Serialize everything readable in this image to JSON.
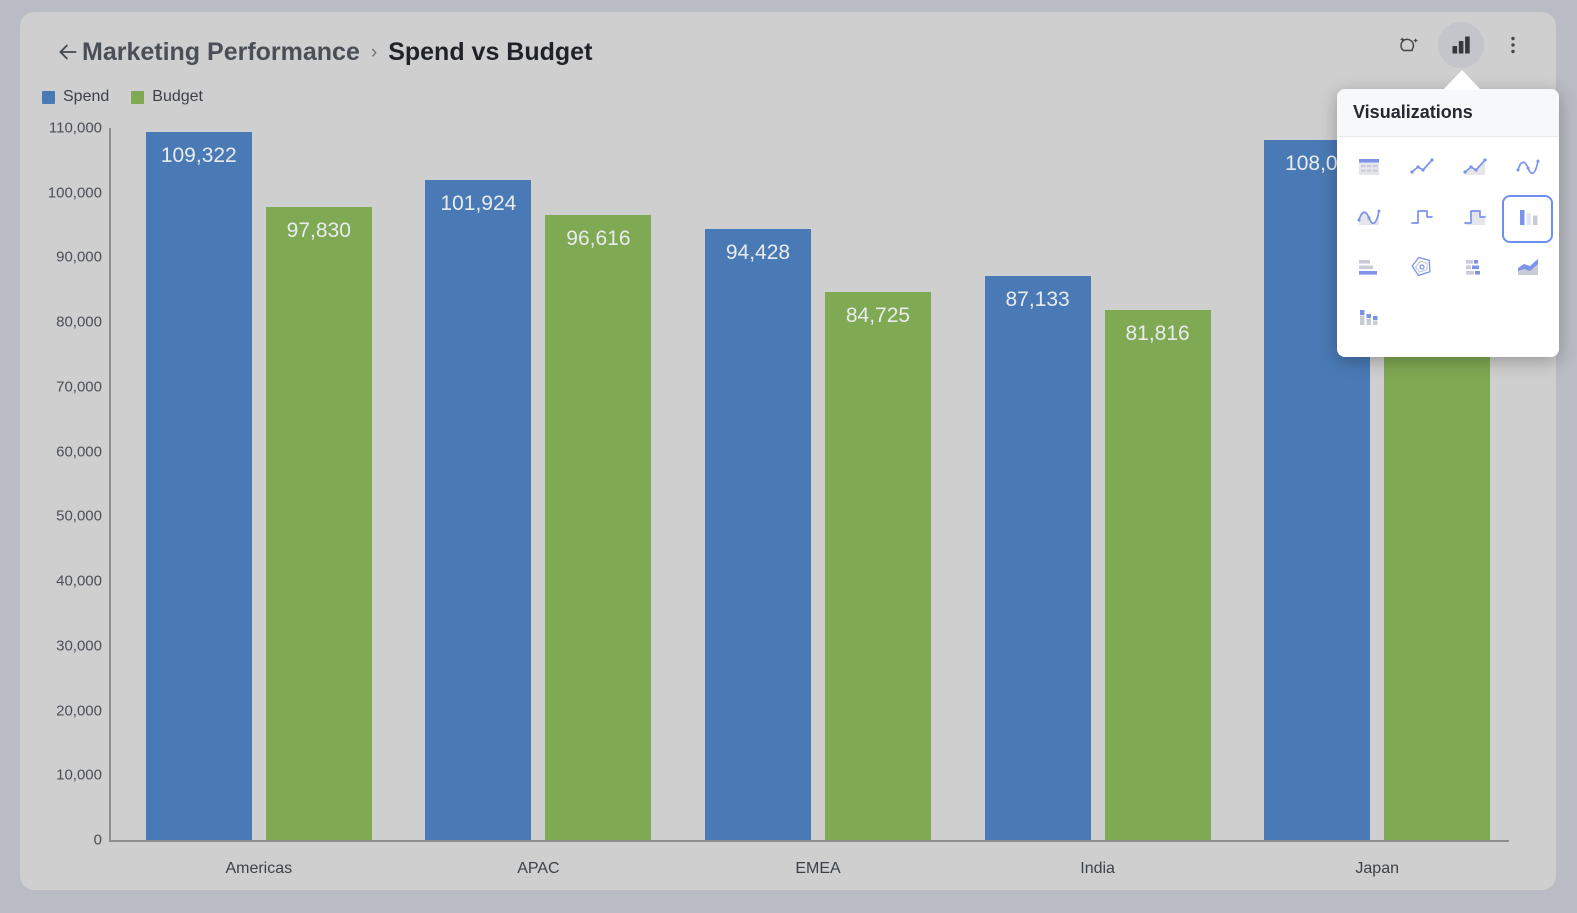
{
  "header": {
    "back_icon": "arrow-left-icon",
    "breadcrumb_parent": "Marketing Performance",
    "breadcrumb_separator": "›",
    "breadcrumb_current": "Spend vs Budget",
    "tools": [
      {
        "name": "ai-insights-icon",
        "label": "AI Insights",
        "active": false
      },
      {
        "name": "visualizations-icon",
        "label": "Visualizations",
        "active": true
      },
      {
        "name": "more-options-icon",
        "label": "More options",
        "active": false
      }
    ]
  },
  "legend": [
    {
      "label": "Spend",
      "color": "#4a7ab5"
    },
    {
      "label": "Budget",
      "color": "#7fa953"
    }
  ],
  "visualizations_panel": {
    "title": "Visualizations",
    "selected": "column-chart",
    "items": [
      {
        "name": "table-icon",
        "label": "Table"
      },
      {
        "name": "line-chart-icon",
        "label": "Line"
      },
      {
        "name": "area-chart-icon",
        "label": "Area"
      },
      {
        "name": "spline-line-icon",
        "label": "Spline"
      },
      {
        "name": "spline-area-icon",
        "label": "Spline Area"
      },
      {
        "name": "step-line-icon",
        "label": "Step Line"
      },
      {
        "name": "step-area-icon",
        "label": "Step Area"
      },
      {
        "name": "column-chart-icon",
        "label": "Column"
      },
      {
        "name": "bar-chart-icon",
        "label": "Bar"
      },
      {
        "name": "pie-chart-icon",
        "label": "Pie"
      },
      {
        "name": "stacked-bar-icon",
        "label": "Stacked Bar"
      },
      {
        "name": "stacked-area-icon",
        "label": "Stacked Area"
      },
      {
        "name": "stacked-column-icon",
        "label": "Stacked Column"
      }
    ]
  },
  "chart_data": {
    "type": "bar",
    "title": "Spend vs Budget",
    "xlabel": "",
    "ylabel": "",
    "ylim": [
      0,
      110000
    ],
    "grid": false,
    "legend_position": "top-left",
    "categories": [
      "Americas",
      "APAC",
      "EMEA",
      "India",
      "Japan"
    ],
    "ytick_labels": [
      "110,000",
      "100,000",
      "90,000",
      "80,000",
      "70,000",
      "60,000",
      "50,000",
      "40,000",
      "30,000",
      "20,000",
      "10,000",
      "0"
    ],
    "ytick_values": [
      110000,
      100000,
      90000,
      80000,
      70000,
      60000,
      50000,
      40000,
      30000,
      20000,
      10000,
      0
    ],
    "series": [
      {
        "name": "Spend",
        "color": "#4a7ab5",
        "values": [
          109322,
          101924,
          94428,
          87133,
          108090
        ],
        "labels": [
          "109,322",
          "101,924",
          "94,428",
          "87,133",
          "108,09"
        ]
      },
      {
        "name": "Budget",
        "color": "#7fa953",
        "values": [
          97830,
          96616,
          84725,
          81816,
          96000
        ],
        "labels": [
          "97,830",
          "96,616",
          "84,725",
          "81,816",
          ""
        ]
      }
    ]
  }
}
